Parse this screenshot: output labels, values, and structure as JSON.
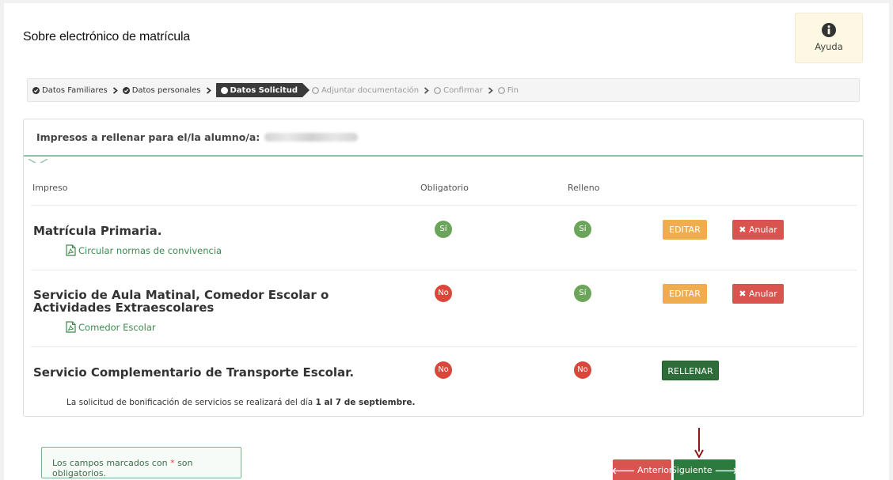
{
  "page": {
    "title": "Sobre electrónico de matrícula"
  },
  "help": {
    "label": "Ayuda",
    "icon": "info-circle-icon"
  },
  "steps": [
    {
      "label": "Datos Familiares",
      "state": "done"
    },
    {
      "label": "Datos personales",
      "state": "done"
    },
    {
      "label": "Datos Solicitud",
      "state": "active"
    },
    {
      "label": "Adjuntar documentación",
      "state": "pending"
    },
    {
      "label": "Confirmar",
      "state": "pending"
    },
    {
      "label": "Fin",
      "state": "pending"
    }
  ],
  "panel": {
    "heading": "Impresos a rellenar para el/la alumno/a:",
    "columns": {
      "impreso": "Impreso",
      "obligatorio": "Obligatorio",
      "relleno": "Relleno"
    },
    "rows": [
      {
        "title": "Matrícula Primaria.",
        "link": "Circular normas de convivencia",
        "obligatorio": "Sí",
        "relleno": "Sí",
        "actions": [
          "EDITAR",
          "Anular"
        ]
      },
      {
        "title": "Servicio de Aula Matinal, Comedor Escolar o Actividades Extraescolares",
        "link": "Comedor Escolar",
        "obligatorio": "No",
        "relleno": "Sí",
        "actions": [
          "EDITAR",
          "Anular"
        ]
      },
      {
        "title": "Servicio Complementario de Transporte Escolar.",
        "obligatorio": "No",
        "relleno": "No",
        "actions": [
          "RELLENAR"
        ]
      }
    ],
    "note_prefix": "La solicitud de bonificación de servicios se realizará del día",
    "note_bold": "1 al 7 de septiembre."
  },
  "footer": {
    "required_prefix": "Los campos marcados con",
    "required_star": "*",
    "required_suffix": "son obligatorios.",
    "prev_label": "Anterior",
    "next_label": "Siguiente"
  },
  "colors": {
    "success": "#6aa55a",
    "danger": "#d9473b",
    "warning": "#f0ad4e",
    "dark_green": "#2d6d3a"
  }
}
